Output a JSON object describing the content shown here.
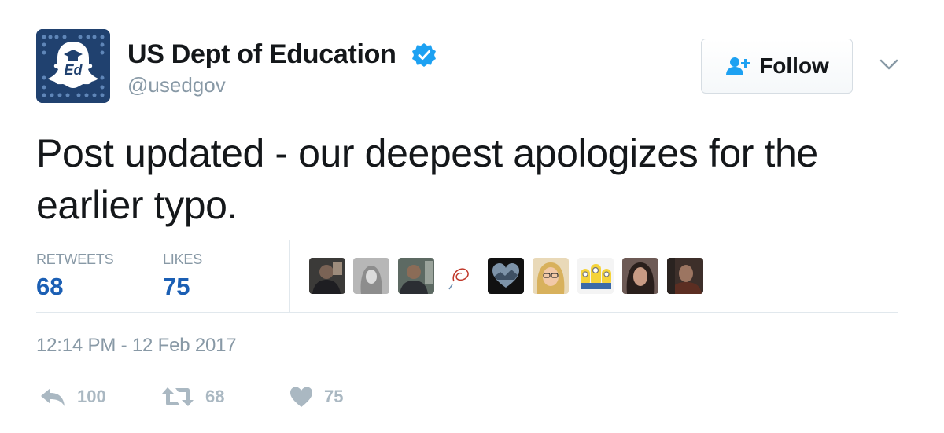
{
  "account": {
    "display_name": "US Dept of Education",
    "handle": "@usedgov",
    "verified": true,
    "avatar": "snapchat-ghost-ed-logo",
    "avatar_text": "Ed"
  },
  "follow_button": {
    "label": "Follow",
    "icon": "add-user-icon"
  },
  "menu": {
    "icon": "chevron-down-icon"
  },
  "tweet": {
    "text": "Post updated - our deepest apologizes for the earlier typo."
  },
  "stats": {
    "retweets_label": "RETWEETS",
    "retweets_value": "68",
    "likes_label": "LIKES",
    "likes_value": "75"
  },
  "likers": [
    {
      "name": "liker-avatar-1",
      "kind": "photo"
    },
    {
      "name": "liker-avatar-2",
      "kind": "photo"
    },
    {
      "name": "liker-avatar-3",
      "kind": "photo"
    },
    {
      "name": "liker-avatar-4",
      "kind": "sketch"
    },
    {
      "name": "liker-avatar-5",
      "kind": "heart-photo"
    },
    {
      "name": "liker-avatar-6",
      "kind": "photo"
    },
    {
      "name": "liker-avatar-7",
      "kind": "minions"
    },
    {
      "name": "liker-avatar-8",
      "kind": "photo"
    },
    {
      "name": "liker-avatar-9",
      "kind": "photo"
    }
  ],
  "timestamp": "12:14 PM - 12 Feb 2017",
  "actions": {
    "reply": {
      "icon": "reply-icon",
      "count": "100"
    },
    "retweet": {
      "icon": "retweet-icon",
      "count": "68"
    },
    "like": {
      "icon": "heart-icon",
      "count": "75"
    }
  },
  "colors": {
    "link_blue": "#1b5fb4",
    "verified_blue": "#1da1f2",
    "muted_gray": "#8899a6",
    "action_gray": "#aab8c2",
    "avatar_bg": "#20416f"
  }
}
